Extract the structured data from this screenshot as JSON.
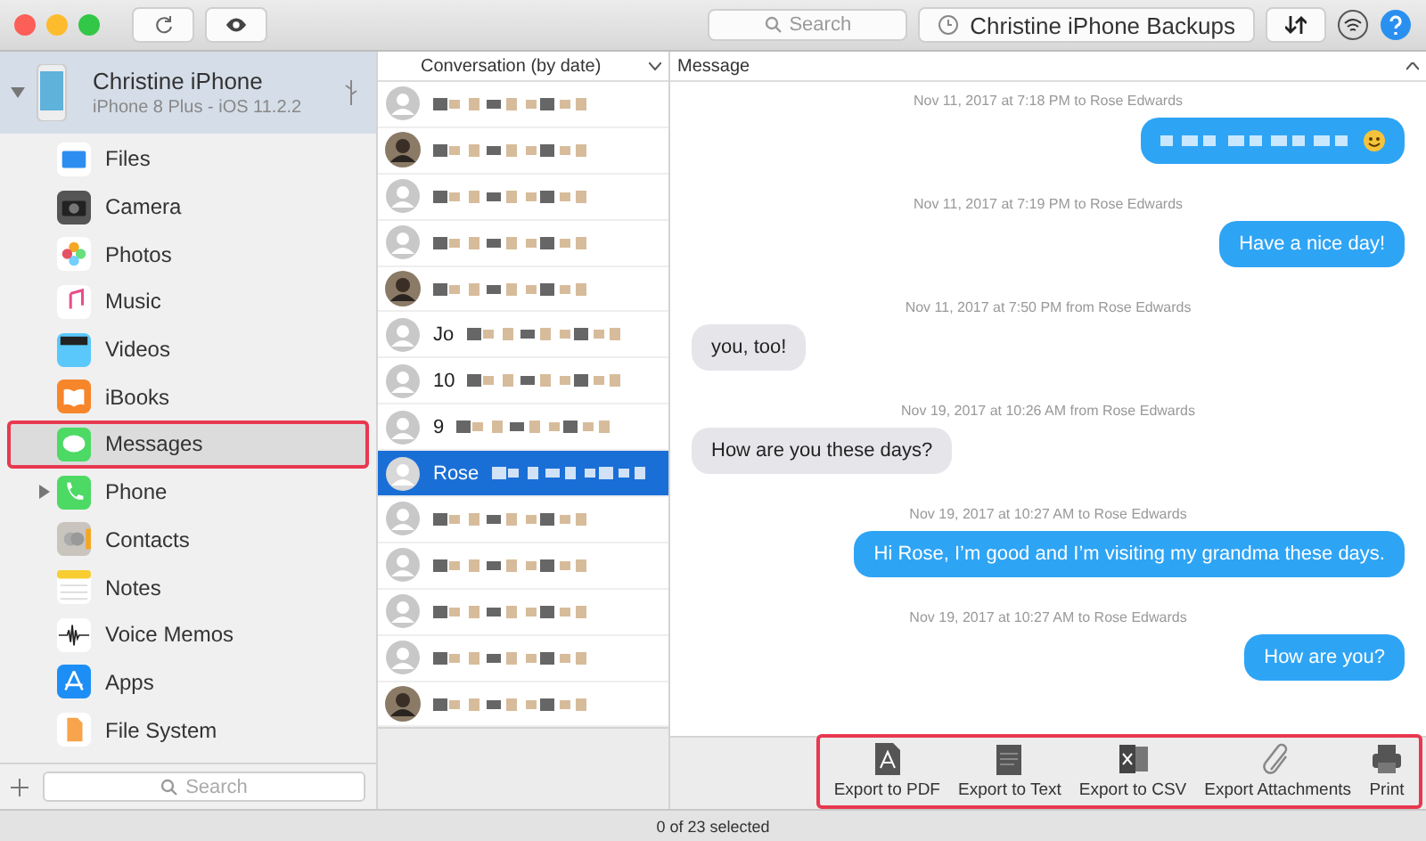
{
  "toolbar": {
    "search_placeholder": "Search",
    "backups_label": "Christine iPhone Backups"
  },
  "device": {
    "name": "Christine iPhone",
    "detail": "iPhone 8 Plus - iOS 11.2.2",
    "expanded": true
  },
  "sidebar": {
    "items": [
      {
        "label": "Files",
        "kind": "files",
        "selected": false,
        "highlighted": false
      },
      {
        "label": "Camera",
        "kind": "camera",
        "selected": false,
        "highlighted": false
      },
      {
        "label": "Photos",
        "kind": "photos",
        "selected": false,
        "highlighted": false
      },
      {
        "label": "Music",
        "kind": "music",
        "selected": false,
        "highlighted": false
      },
      {
        "label": "Videos",
        "kind": "videos",
        "selected": false,
        "highlighted": false
      },
      {
        "label": "iBooks",
        "kind": "ibooks",
        "selected": false,
        "highlighted": false
      },
      {
        "label": "Messages",
        "kind": "messages",
        "selected": true,
        "highlighted": true
      },
      {
        "label": "Phone",
        "kind": "phone",
        "selected": false,
        "highlighted": false,
        "expandable": true
      },
      {
        "label": "Contacts",
        "kind": "contacts",
        "selected": false,
        "highlighted": false
      },
      {
        "label": "Notes",
        "kind": "notes",
        "selected": false,
        "highlighted": false
      },
      {
        "label": "Voice Memos",
        "kind": "voice",
        "selected": false,
        "highlighted": false
      },
      {
        "label": "Apps",
        "kind": "apps",
        "selected": false,
        "highlighted": false
      },
      {
        "label": "File System",
        "kind": "filesystem",
        "selected": false,
        "highlighted": false
      }
    ],
    "search_placeholder": "Search"
  },
  "conversations": {
    "column": "Conversation (by date)",
    "rows": [
      {
        "kind": "default",
        "selected": false
      },
      {
        "kind": "photo",
        "selected": false
      },
      {
        "kind": "default",
        "selected": false
      },
      {
        "kind": "default",
        "selected": false
      },
      {
        "kind": "photo",
        "selected": false
      },
      {
        "kind": "default",
        "name": "Jo",
        "selected": false
      },
      {
        "kind": "default",
        "name": "10",
        "selected": false
      },
      {
        "kind": "default",
        "name": "9",
        "selected": false
      },
      {
        "kind": "default",
        "name": "Rose",
        "selected": true
      },
      {
        "kind": "default",
        "selected": false
      },
      {
        "kind": "default",
        "selected": false
      },
      {
        "kind": "default",
        "selected": false
      },
      {
        "kind": "default",
        "selected": false
      },
      {
        "kind": "photo",
        "selected": false
      }
    ]
  },
  "messages": {
    "column": "Message",
    "items": [
      {
        "time": "Nov 11, 2017 at 7:18 PM to Rose Edwards",
        "kind": "outgoing",
        "redacted": true
      },
      {
        "time": "Nov 11, 2017 at 7:19 PM to Rose Edwards",
        "kind": "outgoing",
        "text": "Have a nice day!"
      },
      {
        "time": "Nov 11, 2017 at 7:50 PM from Rose Edwards",
        "kind": "incoming",
        "text": "you, too!"
      },
      {
        "time": "Nov 19, 2017 at 10:26 AM from Rose Edwards",
        "kind": "incoming",
        "text": "How are you these days?"
      },
      {
        "time": "Nov 19, 2017 at 10:27 AM to Rose Edwards",
        "kind": "outgoing",
        "text": "Hi Rose, I’m good and I’m visiting my grandma these days."
      },
      {
        "time": "Nov 19, 2017 at 10:27 AM to Rose Edwards",
        "kind": "outgoing",
        "text": "How are you?"
      }
    ]
  },
  "export_bar": {
    "highlighted": true,
    "buttons": [
      {
        "label": "Export to PDF",
        "kind": "pdf"
      },
      {
        "label": "Export to Text",
        "kind": "text"
      },
      {
        "label": "Export to CSV",
        "kind": "csv"
      },
      {
        "label": "Export Attachments",
        "kind": "clip"
      },
      {
        "label": "Print",
        "kind": "print"
      }
    ]
  },
  "status_bar": "0 of 23 selected"
}
